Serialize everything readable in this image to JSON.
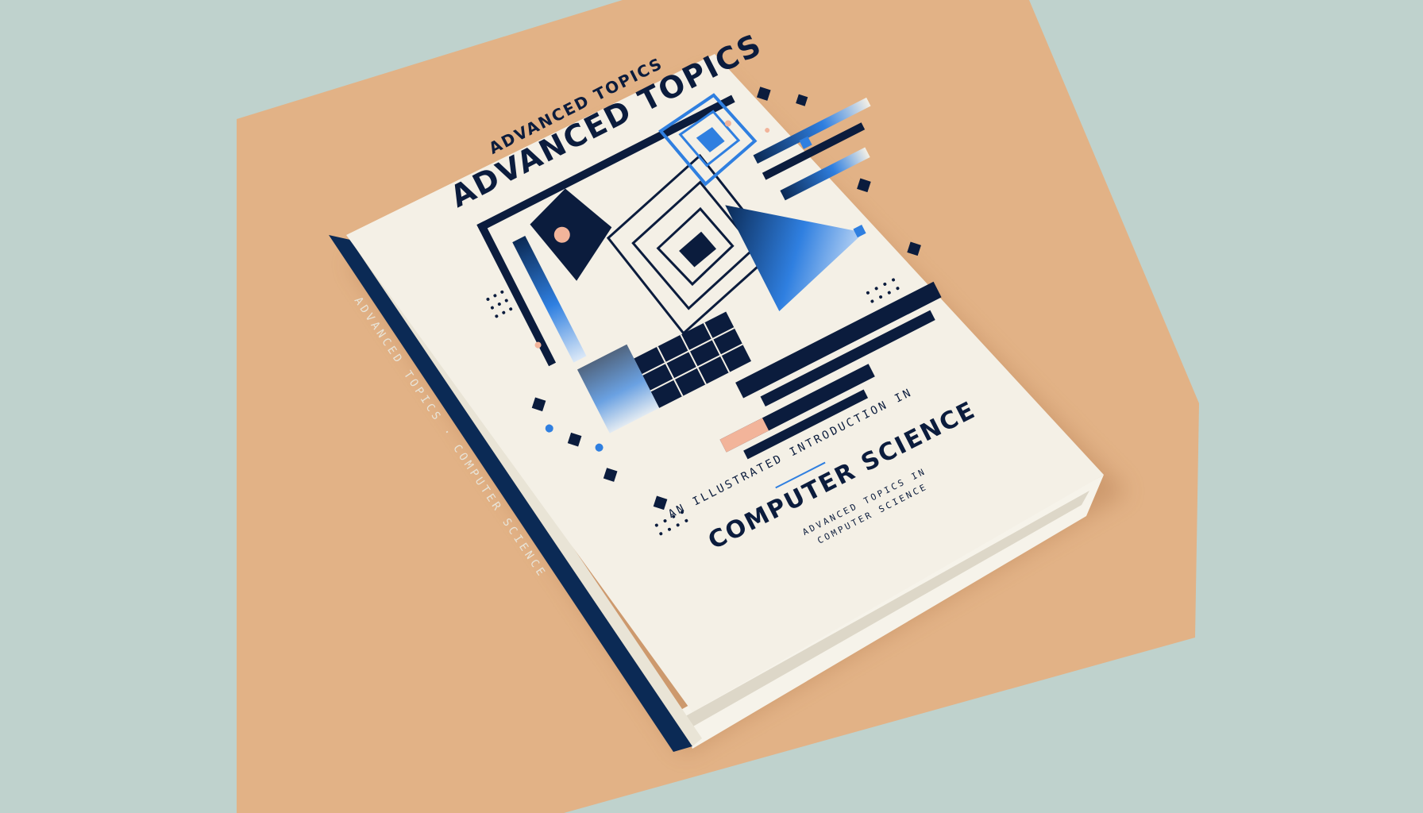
{
  "colors": {
    "background": "#bfd2cd",
    "board": "#e2b286",
    "cover": "#f4f0e6",
    "spine": "#0b2a55",
    "accent_blue": "#2f7fe0",
    "ink": "#0b1c3d",
    "peach": "#f2b49a"
  },
  "book": {
    "small_title": "ADVANCED TOPICS",
    "main_title": "ADVANCED TOPICS",
    "tagline": "AN ILLUSTRATED INTRODUCTION IN",
    "subtitle": "COMPUTER SCIENCE",
    "small_line_1": "ADVANCED TOPICS IN",
    "small_line_2": "COMPUTER SCIENCE",
    "spine_text": "ADVANCED TOPICS · COMPUTER SCIENCE"
  }
}
